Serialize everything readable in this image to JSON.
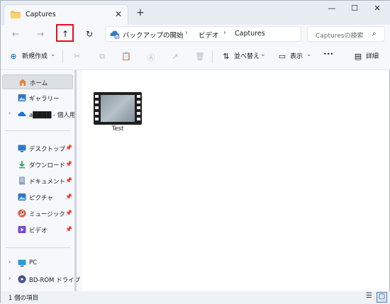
{
  "window": {
    "tab_title": "Captures",
    "tab_close": "✕",
    "new_tab": "+",
    "minimize": "—",
    "maximize": "☐",
    "close": "✕"
  },
  "nav": {
    "back": "←",
    "forward": "→",
    "up": "↑",
    "refresh": "↻"
  },
  "address": {
    "crumbs": [
      "バックアップの開始",
      "ビデオ",
      "Captures"
    ],
    "sep": "›",
    "search_placeholder": "Capturesの検索",
    "search_glyph": "⌕"
  },
  "toolbar": {
    "new_label": "新規作成",
    "new_glyph": "⊕",
    "cut": "✂",
    "copy": "⧉",
    "paste": "📋",
    "rename": "Ⓐ",
    "share": "↗",
    "delete": "🗑",
    "sort_label": "並べ替え",
    "sort_glyph": "⇅",
    "view_label": "表示",
    "view_glyph": "▭",
    "more": "•••",
    "details_label": "詳細",
    "details_glyph": "▤",
    "chev": "⌄"
  },
  "sidebar": {
    "chev": "›",
    "pin": "📌",
    "items": [
      {
        "label": "ホーム"
      },
      {
        "label": "ギャラリー"
      },
      {
        "label": "a████ - 個人用"
      },
      {
        "label": "デスクトップ"
      },
      {
        "label": "ダウンロード"
      },
      {
        "label": "ドキュメント"
      },
      {
        "label": "ピクチャ"
      },
      {
        "label": "ミュージック"
      },
      {
        "label": "ビデオ"
      },
      {
        "label": "PC"
      },
      {
        "label": "BD-ROM ドライブ"
      }
    ]
  },
  "files": [
    {
      "name": "Test",
      "type": "video"
    }
  ],
  "status": {
    "count_text": "1 個の項目",
    "list_view": "☰",
    "icon_view": "▢"
  },
  "colors": {
    "accent": "#0067c0",
    "highlight": "#e0101c",
    "folder": "#f2c14e"
  }
}
